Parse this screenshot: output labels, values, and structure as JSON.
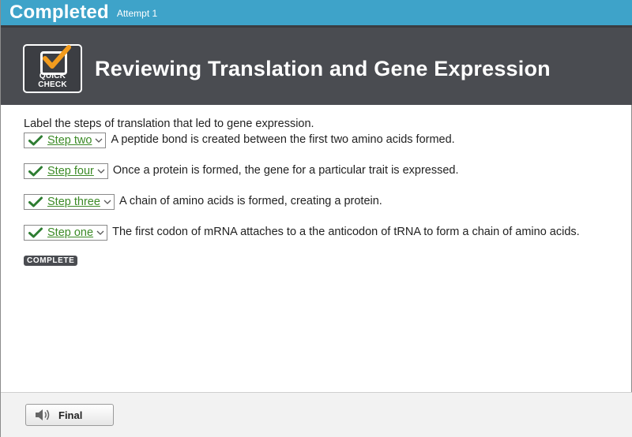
{
  "topbar": {
    "status": "Completed",
    "attempt": "Attempt 1"
  },
  "header": {
    "badge_label": "QUICK CHECK",
    "title": "Reviewing Translation and Gene Expression"
  },
  "content": {
    "prompt": "Label the steps of translation that led to gene expression.",
    "items": [
      {
        "selected": "Step two",
        "text": "A peptide bond is created between the first two amino acids formed.",
        "correct": true
      },
      {
        "selected": "Step four",
        "text": "Once a protein is formed, the gene for a particular trait is expressed.",
        "correct": true
      },
      {
        "selected": "Step three",
        "text": "A chain of amino acids is formed, creating a protein.",
        "correct": true
      },
      {
        "selected": "Step one",
        "text": "The first codon of mRNA attaches to a the anticodon of tRNA to form a chain of amino acids.",
        "correct": true
      }
    ],
    "complete_badge": "COMPLETE"
  },
  "footer": {
    "final_label": "Final",
    "icon": "speaker-icon"
  },
  "colors": {
    "topbar": "#3ea3c9",
    "header": "#4a4c51",
    "correct_green": "#3b8a26",
    "check_orange": "#f39c1e"
  }
}
